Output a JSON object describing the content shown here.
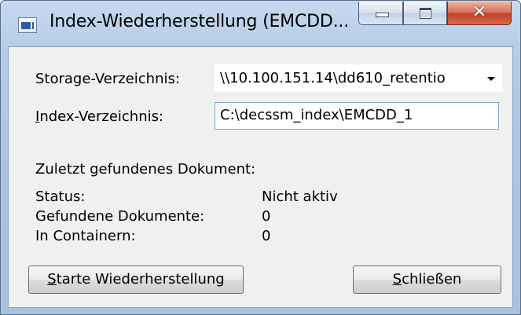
{
  "window": {
    "title": "Index-Wiederherstellung (EMCDD...",
    "icon": "app-window-icon",
    "controls": {
      "minimize": "minimize-icon",
      "maximize": "maximize-icon",
      "close": "✕"
    }
  },
  "form": {
    "storage_label": "Storage-Verzeichnis:",
    "storage_value": "\\\\10.100.151.14\\dd610_retentio",
    "index_label_first": "I",
    "index_label_rest": "ndex-Verzeichnis:",
    "index_value": "C:\\decssm_index\\EMCDD_1"
  },
  "info": {
    "last_doc_label": "Zuletzt gefundenes Dokument:",
    "status_label": "Status:",
    "status_value": "Nicht aktiv",
    "found_label": "Gefundene Dokumente:",
    "found_value": "0",
    "containers_label": "In Containern:",
    "containers_value": "0"
  },
  "buttons": {
    "start_first": "S",
    "start_rest": "tarte Wiederherstellung",
    "close_first": "S",
    "close_rest": "chließen"
  }
}
